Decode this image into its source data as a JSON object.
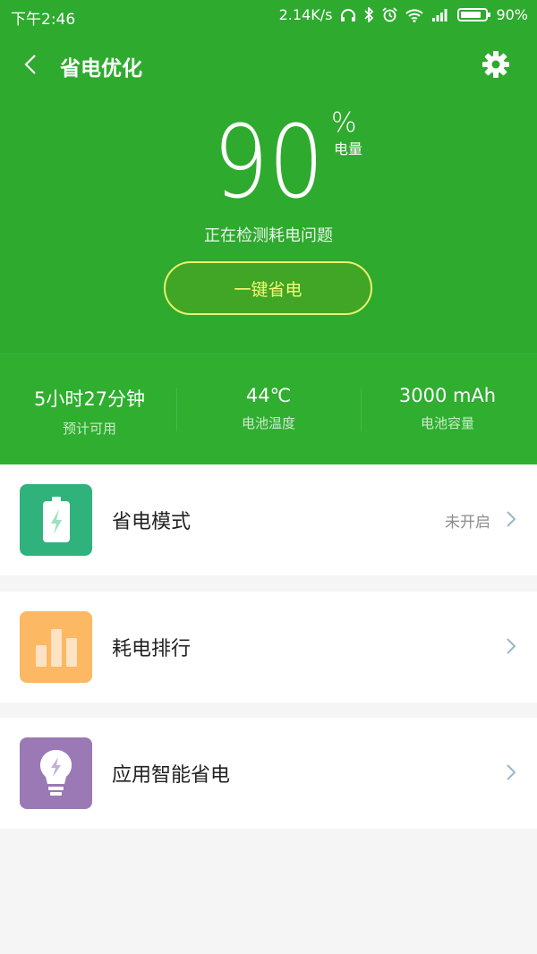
{
  "status_bar": {
    "time": "下午2:46",
    "net_speed": "2.14K/s",
    "battery": "90%"
  },
  "header": {
    "title": "省电优化",
    "back_icon": "chevron-left-icon",
    "settings_icon": "gear-icon"
  },
  "battery": {
    "level": "90",
    "percent_sign": "%",
    "unit_label": "电量",
    "detecting_text": "正在检测耗电问题",
    "action_button": "一键省电"
  },
  "stats": [
    {
      "value": "5小时27分钟",
      "label": "预计可用"
    },
    {
      "value": "44℃",
      "label": "电池温度"
    },
    {
      "value": "3000 mAh",
      "label": "电池容量"
    }
  ],
  "menu": [
    {
      "label": "省电模式",
      "status": "未开启",
      "icon": "battery-charging-icon",
      "color": "#2fb27c"
    },
    {
      "label": "耗电排行",
      "status": "",
      "icon": "bar-chart-icon",
      "color": "#fcb862"
    },
    {
      "label": "应用智能省电",
      "status": "",
      "icon": "lightbulb-icon",
      "color": "#9b79b4"
    }
  ],
  "colors": {
    "header_green": "#2eaa2e",
    "button_yellow": "#e9f36c"
  }
}
